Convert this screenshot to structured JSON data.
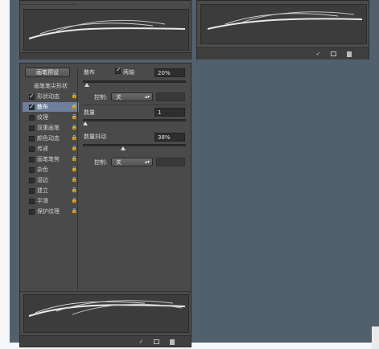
{
  "top_left": {
    "footer_icons": [
      "eye-brush-icon",
      "grid-icon",
      "page-icon"
    ]
  },
  "top_right": {
    "footer_icons": [
      "eye-brush-icon",
      "grid-icon",
      "page-icon"
    ]
  },
  "panel": {
    "preset_button": "画笔预设",
    "list_header": "画笔笔尖形状",
    "items": [
      {
        "label": "形状动态",
        "checked": true,
        "selected": false
      },
      {
        "label": "散布",
        "checked": true,
        "selected": true
      },
      {
        "label": "纹理",
        "checked": false,
        "selected": false
      },
      {
        "label": "双重画笔",
        "checked": false,
        "selected": false
      },
      {
        "label": "颜色动态",
        "checked": false,
        "selected": false
      },
      {
        "label": "传递",
        "checked": false,
        "selected": false
      },
      {
        "label": "画笔笔势",
        "checked": false,
        "selected": false
      },
      {
        "label": "杂色",
        "checked": false,
        "selected": false
      },
      {
        "label": "湿边",
        "checked": false,
        "selected": false
      },
      {
        "label": "建立",
        "checked": false,
        "selected": false
      },
      {
        "label": "平滑",
        "checked": false,
        "selected": false
      },
      {
        "label": "保护纹理",
        "checked": false,
        "selected": false
      }
    ],
    "lock_glyph": "🔒",
    "scatter": {
      "label": "散布",
      "both_axes_label": "两轴",
      "both_axes_checked": true,
      "value": "20%",
      "level": 0.02,
      "control_label": "控制:",
      "control_value": "关"
    },
    "count": {
      "label": "数量",
      "value": "1",
      "level": 0.0
    },
    "count_jitter": {
      "label": "数量抖动",
      "value": "38%",
      "level": 0.38,
      "control_label": "控制:",
      "control_value": "关"
    },
    "footer_icons": [
      "eye-brush-icon",
      "grid-icon",
      "page-icon"
    ]
  }
}
